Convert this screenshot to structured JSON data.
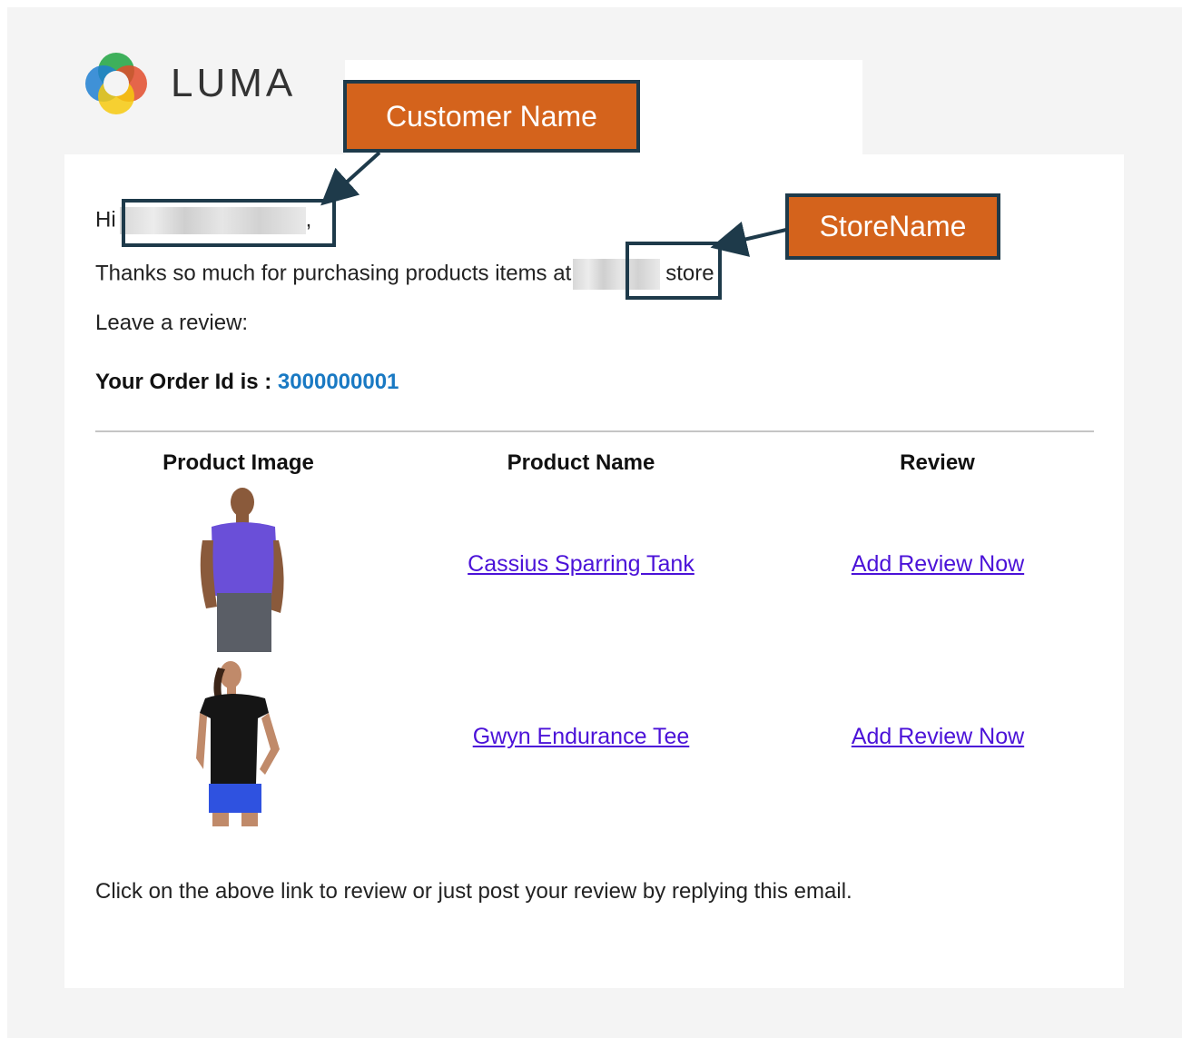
{
  "brand": {
    "logo_text": "LUMA",
    "logo_icon": "luma-rings-icon"
  },
  "email": {
    "greeting_prefix": "Hi",
    "greeting_suffix": ",",
    "thanks_prefix": "Thanks so much for purchasing products items at",
    "thanks_suffix": "store",
    "leave_review": "Leave a review:",
    "order_label": "Your Order Id is :",
    "order_id": "3000000001",
    "footer": "Click on the above link to review or just post your review by replying this email."
  },
  "table": {
    "headers": [
      "Product Image",
      "Product Name",
      "Review"
    ],
    "rows": [
      {
        "product_name": "Cassius Sparring Tank",
        "review_link": "Add Review Now",
        "image": "man-purple-tank-photo"
      },
      {
        "product_name": "Gwyn Endurance Tee",
        "review_link": "Add Review Now",
        "image": "woman-black-tee-photo"
      }
    ]
  },
  "annotations": {
    "customer_name": "Customer Name",
    "store_name": "StoreName"
  },
  "colors": {
    "callout_bg": "#d4631c",
    "callout_border": "#1e3a4a",
    "order_id": "#1979c3",
    "link": "#4b12d8"
  }
}
